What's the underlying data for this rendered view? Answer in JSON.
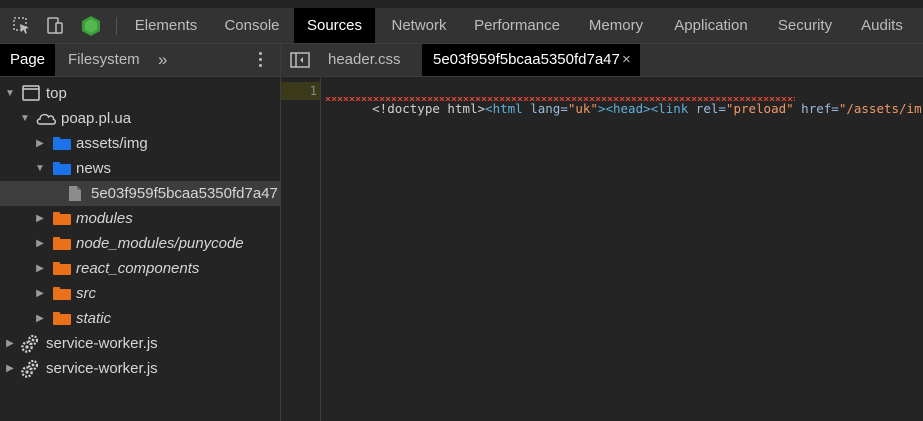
{
  "toolbar": {
    "tabs": [
      {
        "label": "Elements"
      },
      {
        "label": "Console"
      },
      {
        "label": "Sources"
      },
      {
        "label": "Network"
      },
      {
        "label": "Performance"
      },
      {
        "label": "Memory"
      },
      {
        "label": "Application"
      },
      {
        "label": "Security"
      },
      {
        "label": "Audits"
      }
    ],
    "active_tab": "Sources"
  },
  "navigator": {
    "tabs": [
      {
        "label": "Page"
      },
      {
        "label": "Filesystem"
      }
    ],
    "more": "»",
    "tree": [
      {
        "label": "top",
        "icon": "frame-icon",
        "expanded": true
      },
      {
        "label": "poap.pl.ua",
        "icon": "cloud-icon",
        "expanded": true
      },
      {
        "label": "assets/img",
        "icon": "folder-icon",
        "color": "#1a73e8"
      },
      {
        "label": "news",
        "icon": "folder-icon",
        "color": "#1a73e8",
        "expanded": true
      },
      {
        "label": "5e03f959f5bcaa5350fd7a47",
        "icon": "file-icon",
        "selected": true
      },
      {
        "label": "modules",
        "icon": "folder-icon",
        "color": "#e8711a"
      },
      {
        "label": "node_modules/punycode",
        "icon": "folder-icon",
        "color": "#e8711a"
      },
      {
        "label": "react_components",
        "icon": "folder-icon",
        "color": "#e8711a"
      },
      {
        "label": "src",
        "icon": "folder-icon",
        "color": "#e8711a"
      },
      {
        "label": "static",
        "icon": "folder-icon",
        "color": "#e8711a"
      },
      {
        "label": "service-worker.js",
        "icon": "gear-icon"
      },
      {
        "label": "service-worker.js",
        "icon": "gear-icon"
      }
    ]
  },
  "editor": {
    "tabs": [
      {
        "label": "header.css"
      },
      {
        "label": "5e03f959f5bcaa5350fd7a47",
        "close": "×"
      }
    ],
    "lines": [
      {
        "number": "1",
        "tokens": [
          {
            "text": "<!doctype html>",
            "color": "#d0d0d0"
          },
          {
            "text": "<html",
            "color": "#5db0d7"
          },
          {
            "text": " lang=",
            "color": "#9bbbdc"
          },
          {
            "text": "\"uk\"",
            "color": "#f29766"
          },
          {
            "text": ">",
            "color": "#5db0d7"
          },
          {
            "text": "<head>",
            "color": "#5db0d7"
          },
          {
            "text": "<link",
            "color": "#5db0d7"
          },
          {
            "text": " rel=",
            "color": "#9bbbdc"
          },
          {
            "text": "\"preload\"",
            "color": "#f29766"
          },
          {
            "text": " href=",
            "color": "#9bbbdc"
          },
          {
            "text": "\"/assets/im",
            "color": "#f29766"
          }
        ]
      }
    ]
  },
  "colors": {
    "accent_blue": "#1a73e8",
    "accent_orange": "#e8711a",
    "error_red": "#e0453a"
  }
}
